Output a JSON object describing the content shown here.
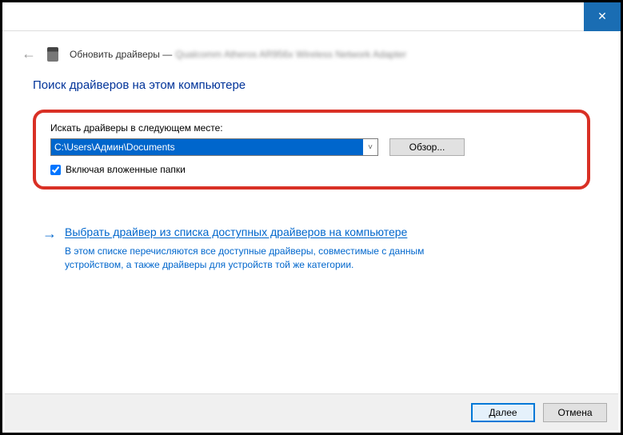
{
  "titlebar": {
    "close_tooltip": "Close"
  },
  "header": {
    "action": "Обновить драйверы —",
    "device": "Qualcomm Atheros AR956x Wireless Network Adapter"
  },
  "page": {
    "title": "Поиск драйверов на этом компьютере"
  },
  "search": {
    "label": "Искать драйверы в следующем месте:",
    "path": "C:\\Users\\Админ\\Documents",
    "browse_label": "Обзор...",
    "include_subfolders_label": "Включая вложенные папки",
    "include_subfolders_checked": true
  },
  "picker": {
    "link": "Выбрать драйвер из списка доступных драйверов на компьютере",
    "desc": "В этом списке перечисляются все доступные драйверы, совместимые с данным устройством, а также драйверы для устройств той же категории."
  },
  "footer": {
    "next": "Далее",
    "cancel": "Отмена"
  }
}
